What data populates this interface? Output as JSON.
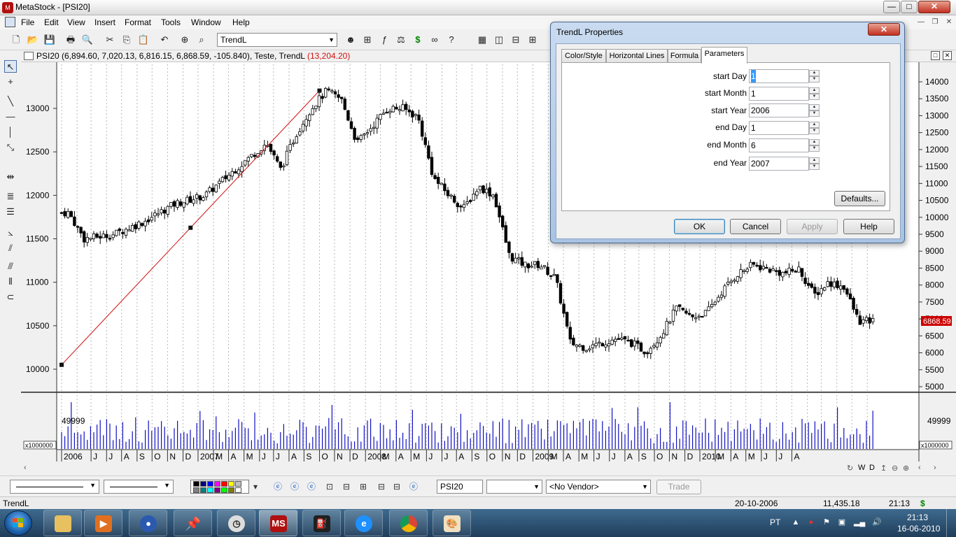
{
  "window": {
    "title": "MetaStock - [PSI20]",
    "min": "—",
    "max": "□",
    "close": "✕"
  },
  "menu": [
    "File",
    "Edit",
    "View",
    "Insert",
    "Format",
    "Tools",
    "Window",
    "Help"
  ],
  "toolbar": {
    "indicator_combo": "TrendL"
  },
  "chart_header": {
    "symbol": "PSI20",
    "values": " (6,894.60, 7,020.13, 6,816.15, 6,868.59, -105.840), Teste, TrendL ",
    "trendl_value": "(13,204.20)"
  },
  "chart_data": [
    {
      "type": "candlestick",
      "series_name": "PSI20",
      "left_axis_ticks": [
        "13000",
        "12500",
        "12000",
        "11500",
        "11000",
        "10500",
        "10000"
      ],
      "right_axis_ticks": [
        "14000",
        "13500",
        "13000",
        "12500",
        "12000",
        "11500",
        "11000",
        "10500",
        "10000",
        "9500",
        "9000",
        "8500",
        "8000",
        "7500",
        "7000",
        "6500",
        "6000",
        "5500",
        "5000"
      ],
      "last_price_tag": "6868.59",
      "x_ticks": [
        "2006",
        "J",
        "J",
        "A",
        "S",
        "O",
        "N",
        "D",
        "2007",
        "M",
        "A",
        "M",
        "J",
        "J",
        "A",
        "S",
        "O",
        "N",
        "D",
        "2008",
        "M",
        "A",
        "M",
        "J",
        "J",
        "A",
        "S",
        "O",
        "N",
        "D",
        "2009",
        "M",
        "A",
        "M",
        "J",
        "J",
        "A",
        "S",
        "O",
        "N",
        "D",
        "2010",
        "M",
        "A",
        "M",
        "J",
        "J",
        "A"
      ],
      "trendline": {
        "start": "2006-01-01",
        "end": "2007-06-01",
        "value_start": 10050,
        "value_end": 13204.2
      },
      "close_anchors_approx": [
        [
          "2006-01",
          11800
        ],
        [
          "2006-02",
          11500
        ],
        [
          "2006-04",
          11550
        ],
        [
          "2006-06",
          11700
        ],
        [
          "2006-08",
          11900
        ],
        [
          "2006-10",
          12000
        ],
        [
          "2006-12",
          12300
        ],
        [
          "2007-02",
          12600
        ],
        [
          "2007-03",
          12300
        ],
        [
          "2007-04",
          12700
        ],
        [
          "2007-05",
          13000
        ],
        [
          "2007-06",
          13200
        ],
        [
          "2007-07",
          13100
        ],
        [
          "2007-08",
          12600
        ],
        [
          "2007-09",
          12800
        ],
        [
          "2007-10",
          13000
        ],
        [
          "2007-11",
          13000
        ],
        [
          "2007-12",
          12900
        ],
        [
          "2008-01",
          12200
        ],
        [
          "2008-02",
          12000
        ],
        [
          "2008-03",
          11850
        ],
        [
          "2008-04",
          12100
        ],
        [
          "2008-05",
          12000
        ],
        [
          "2008-06",
          11300
        ],
        [
          "2008-07",
          11200
        ],
        [
          "2008-08",
          11200
        ],
        [
          "2008-09",
          11050
        ],
        [
          "2008-10",
          10300
        ],
        [
          "2008-11",
          10250
        ],
        [
          "2008-12",
          10300
        ],
        [
          "2009-01",
          10350
        ],
        [
          "2009-02",
          10300
        ],
        [
          "2009-03",
          10200
        ],
        [
          "2009-04",
          10400
        ],
        [
          "2009-05",
          10700
        ],
        [
          "2009-06",
          10600
        ],
        [
          "2009-07",
          10650
        ],
        [
          "2009-08",
          10900
        ],
        [
          "2009-09",
          11100
        ],
        [
          "2009-10",
          11200
        ],
        [
          "2009-11",
          11150
        ],
        [
          "2009-12",
          11100
        ],
        [
          "2010-01",
          11150
        ],
        [
          "2010-02",
          10850
        ],
        [
          "2010-03",
          11000
        ],
        [
          "2010-04",
          10950
        ],
        [
          "2010-05",
          10550
        ],
        [
          "2010-06",
          10550
        ]
      ]
    },
    {
      "type": "bar",
      "series_name": "Volume",
      "axis_label": "49999",
      "scale_tag": "x1000000"
    }
  ],
  "hscroll": {
    "left_arrow": "‹",
    "right_ctrls": [
      "↻",
      "W",
      "D",
      "↥",
      "⊖",
      "⊕",
      "‹",
      "›"
    ]
  },
  "bottom_toolbar": {
    "symbol_field": "PSI20",
    "period_field": "",
    "vendor_field": "<No Vendor>",
    "trade_label": "Trade"
  },
  "status": {
    "tool": "TrendL",
    "date": "20-10-2006",
    "value": "11,435.18",
    "time": "21:13",
    "icon": "$"
  },
  "taskbar": {
    "apps": [
      "explorer",
      "media-player",
      "messenger",
      "pin",
      "clock",
      "MS",
      "gas-pump",
      "internet-explorer",
      "chrome",
      "paint"
    ],
    "lang": "PT",
    "clock_time": "21:13",
    "clock_date": "16-06-2010"
  },
  "dialog": {
    "title": "TrendL Properties",
    "close": "✕",
    "tabs": [
      "Color/Style",
      "Horizontal Lines",
      "Formula",
      "Parameters"
    ],
    "fields": [
      {
        "label": "start Day",
        "value": "1"
      },
      {
        "label": "start Month",
        "value": "1"
      },
      {
        "label": "start Year",
        "value": "2006"
      },
      {
        "label": "end Day",
        "value": "1"
      },
      {
        "label": "end Month",
        "value": "6"
      },
      {
        "label": "end Year",
        "value": "2007"
      }
    ],
    "defaults_btn": "Defaults...",
    "ok_btn": "OK",
    "cancel_btn": "Cancel",
    "apply_btn": "Apply",
    "help_btn": "Help"
  },
  "colors": {
    "trendline": "#d01010",
    "volume": "#1010c0",
    "price_tag": "#cc0000",
    "accent": "#3c7fb1"
  }
}
